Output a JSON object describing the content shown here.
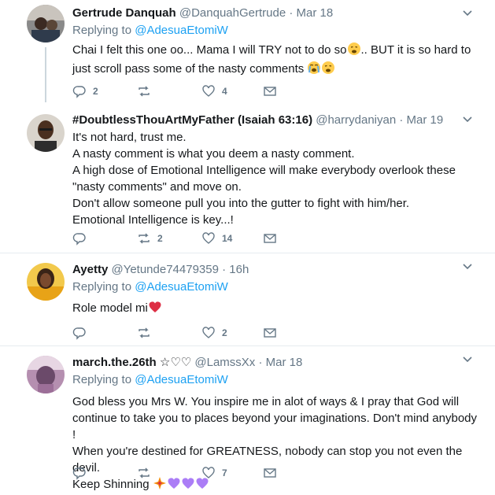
{
  "tweets": [
    {
      "name": "Gertrude Danquah",
      "handle": "@DanquahGertrude",
      "dot": "·",
      "time": "Mar 18",
      "replying_prefix": "Replying to ",
      "replying_to": "@AdesuaEtomiW",
      "lines": [
        "Chai I felt this one oo... Mama I will TRY not to do so",
        ".. BUT it is so hard to",
        "just scroll pass some of the nasty comments "
      ],
      "reply_count": "2",
      "retweet_count": "",
      "like_count": "4"
    },
    {
      "name": "#DoubtlessThouArtMyFather (Isaiah 63:16)",
      "handle": "@harrydaniyan",
      "dot": "·",
      "time": "Mar 19",
      "lines": [
        "It's not hard, trust me.",
        "A nasty comment is what you deem a nasty comment.",
        "A high dose of Emotional Intelligence will make everybody overlook these",
        "\"nasty comments\" and move on.",
        "Don't allow someone pull you into the gutter to fight with him/her.",
        "Emotional Intelligence is key...!"
      ],
      "reply_count": "",
      "retweet_count": "2",
      "like_count": "14"
    },
    {
      "name": "Ayetty",
      "handle": "@Yetunde74479359",
      "dot": "·",
      "time": "16h",
      "replying_prefix": "Replying to ",
      "replying_to": "@AdesuaEtomiW",
      "lines": [
        "Role model mi"
      ],
      "reply_count": "",
      "retweet_count": "",
      "like_count": "2"
    },
    {
      "name": "march.the.26th",
      "name_symbols": "☆♡♡",
      "handle": "@LamssXx",
      "dot": "·",
      "time": "Mar 18",
      "replying_prefix": "Replying to ",
      "replying_to": "@AdesuaEtomiW",
      "lines": [
        "God bless you Mrs W. You inspire me in alot of ways & I pray that God will",
        "continue to take you to places beyond your imaginations. Don't mind anybody !",
        "When you're destined for GREATNESS, nobody can stop you not even the devil.",
        "Keep Shinning "
      ],
      "reply_count": "",
      "retweet_count": "",
      "like_count": "7"
    }
  ],
  "colors": {
    "link": "#1da1f2",
    "secondary": "#657786",
    "divider": "#e6ecf0",
    "thread_line": "#ccd6dd",
    "heart": "#e0245e",
    "purple_heart": "#ab7df6"
  }
}
